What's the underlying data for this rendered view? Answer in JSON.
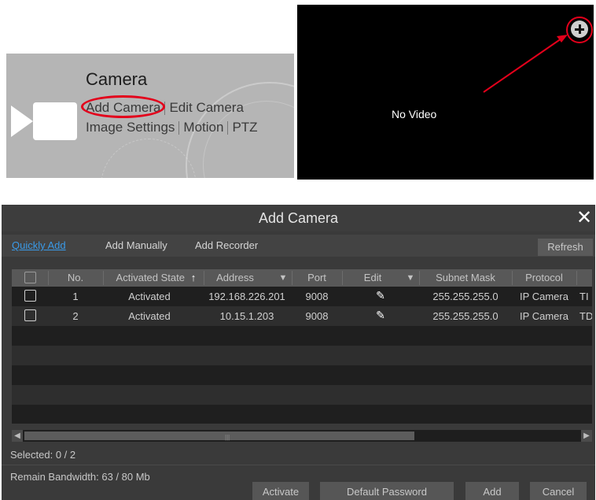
{
  "camera_menu": {
    "title": "Camera",
    "links": [
      "Add Camera",
      "Edit Camera",
      "Image Settings",
      "Motion",
      "PTZ"
    ]
  },
  "video": {
    "no_video_text": "No Video",
    "add_icon": "plus-icon"
  },
  "annotation_color": "#e3001b",
  "dialog": {
    "title": "Add Camera",
    "close_icon": "close-icon",
    "tabs": [
      "Quickly Add",
      "Add Manually",
      "Add Recorder"
    ],
    "active_tab": "Quickly Add",
    "refresh_label": "Refresh",
    "table": {
      "headers": [
        "No.",
        "Activated State",
        "Address",
        "Port",
        "Edit",
        "Subnet Mask",
        "Protocol"
      ],
      "sort_icon": "↑",
      "rows": [
        {
          "no": "1",
          "state": "Activated",
          "address": "192.168.226.201",
          "port": "9008",
          "subnet": "255.255.255.0",
          "protocol": "IP Camera",
          "extra": "TI"
        },
        {
          "no": "2",
          "state": "Activated",
          "address": "10.15.1.203",
          "port": "9008",
          "subnet": "255.255.255.0",
          "protocol": "IP Camera",
          "extra": "TD"
        }
      ]
    },
    "selected": "Selected: 0 / 2",
    "bandwidth": "Remain Bandwidth: 63 / 80 Mb",
    "buttons": {
      "activate": "Activate",
      "default_password": "Default Password",
      "add": "Add",
      "cancel": "Cancel"
    }
  }
}
